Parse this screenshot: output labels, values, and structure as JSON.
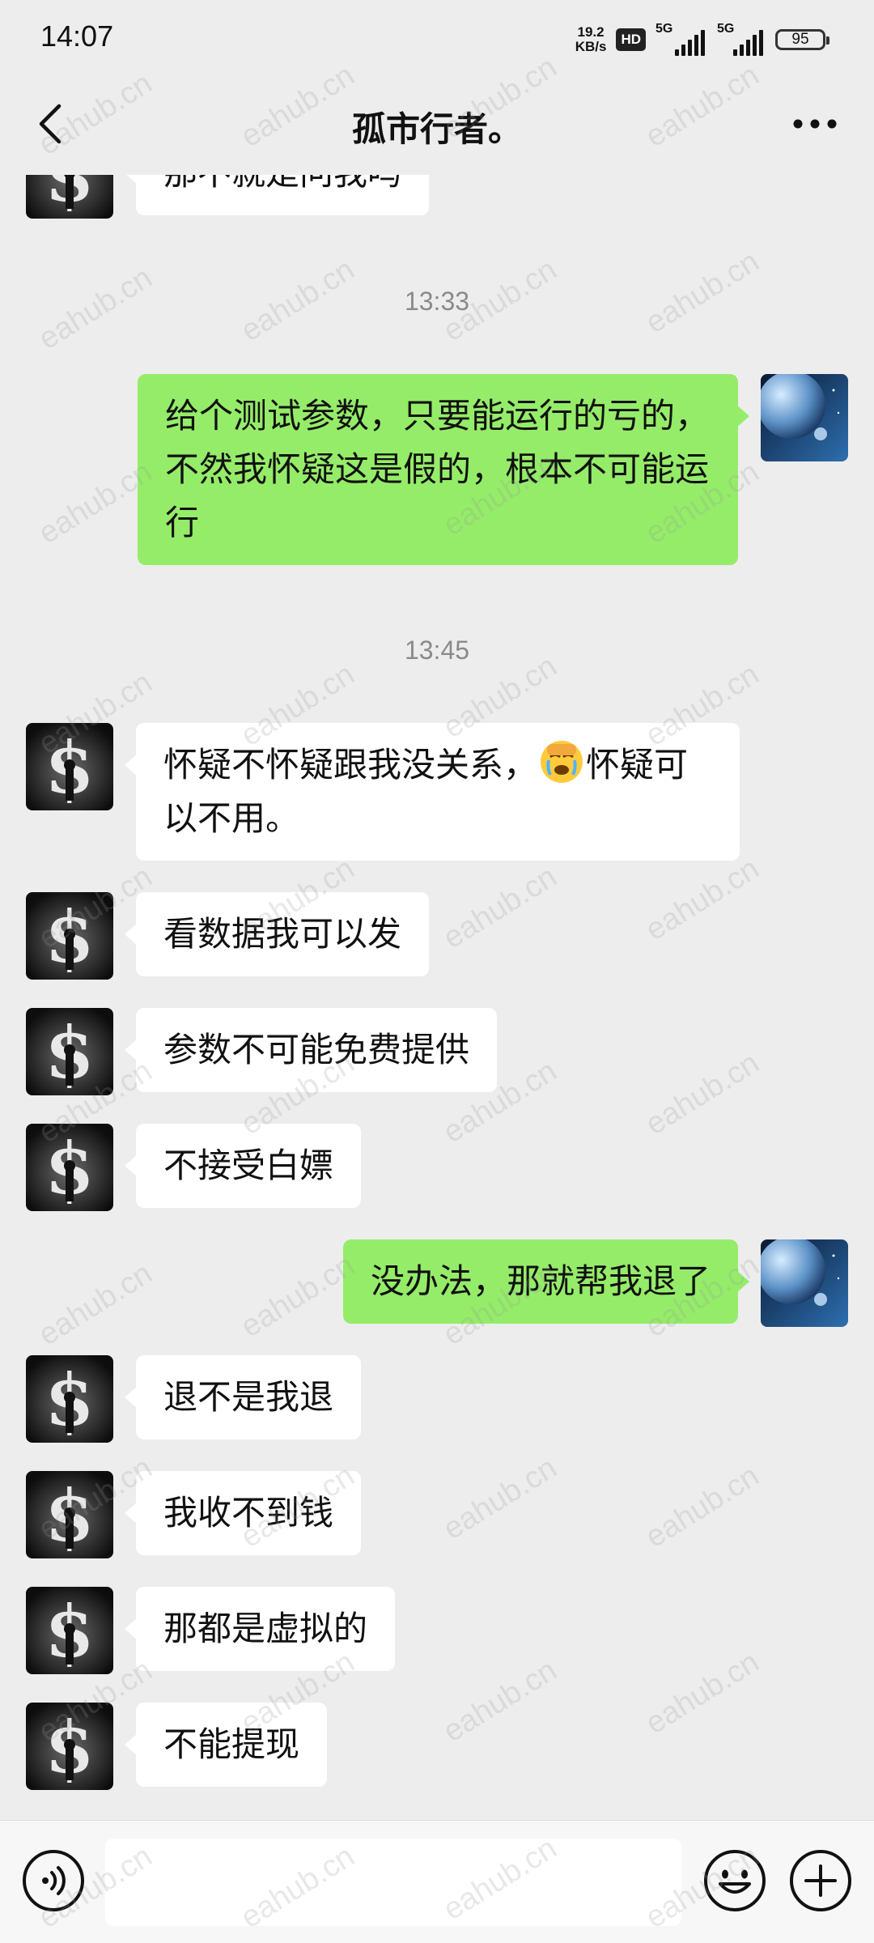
{
  "status_bar": {
    "time": "14:07",
    "net_speed_value": "19.2",
    "net_speed_unit": "KB/s",
    "hd_label": "HD",
    "signal1_label": "5G",
    "signal2_label": "5G",
    "battery_level": "95"
  },
  "header": {
    "title": "孤市行者。",
    "back_icon": "chevron-left-icon",
    "more_icon": "more-dots-icon"
  },
  "messages": [
    {
      "type": "text",
      "side": "in",
      "text": "那不就是问我吗"
    },
    {
      "type": "time",
      "text": "13:33"
    },
    {
      "type": "text",
      "side": "out",
      "text": "给个测试参数，只要能运行的亏的，不然我怀疑这是假的，根本不可能运行"
    },
    {
      "type": "time",
      "text": "13:45"
    },
    {
      "type": "text",
      "side": "in",
      "text_before": "怀疑不怀疑跟我没关系，",
      "emoji": "facepalm-crying-emoji",
      "text_after": "怀疑可以不用。"
    },
    {
      "type": "text",
      "side": "in",
      "text": "看数据我可以发"
    },
    {
      "type": "text",
      "side": "in",
      "text": "参数不可能免费提供"
    },
    {
      "type": "text",
      "side": "in",
      "text": "不接受白嫖"
    },
    {
      "type": "text",
      "side": "out",
      "text": "没办法，那就帮我退了"
    },
    {
      "type": "text",
      "side": "in",
      "text": "退不是我退"
    },
    {
      "type": "text",
      "side": "in",
      "text": "我收不到钱"
    },
    {
      "type": "text",
      "side": "in",
      "text": "那都是虚拟的"
    },
    {
      "type": "text",
      "side": "in",
      "text": "不能提现"
    }
  ],
  "watermark": {
    "text": "eahub.cn"
  },
  "input_bar": {
    "input_value": "",
    "voice_icon": "voice-icon",
    "emoji_icon": "emoji-icon",
    "plus_icon": "plus-icon"
  },
  "colors": {
    "background": "#ededed",
    "bubble_out": "#95ec69",
    "bubble_in": "#ffffff",
    "timestamp": "#8a8a8a"
  }
}
